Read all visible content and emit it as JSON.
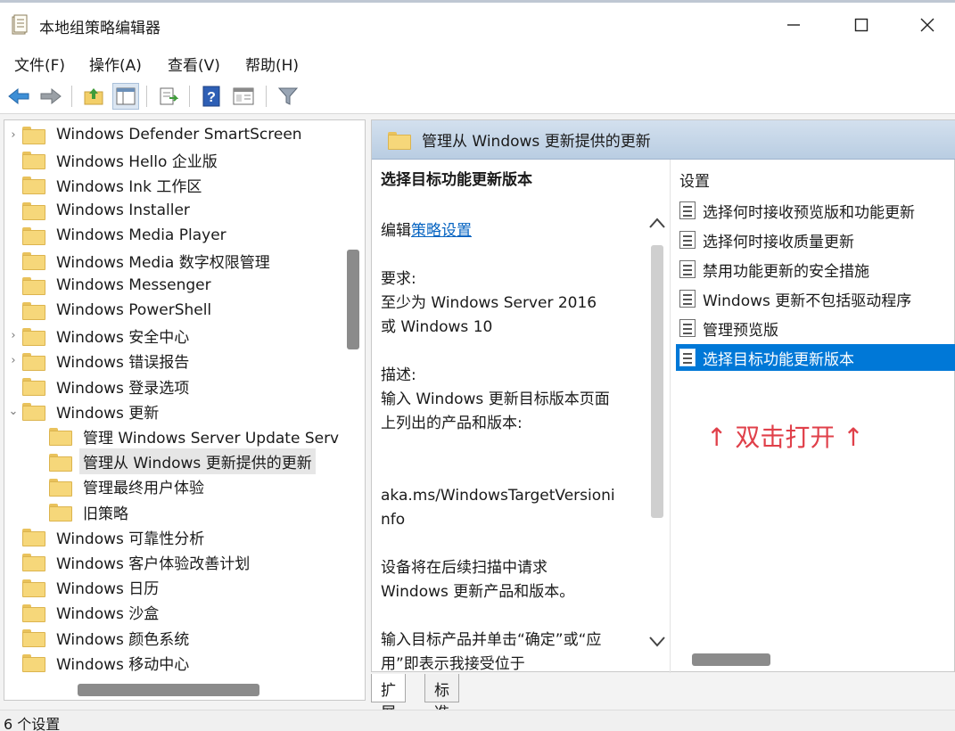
{
  "window": {
    "title": "本地组策略编辑器",
    "minimize_glyph": "—",
    "maximize_glyph": "☐",
    "close_glyph": "✕"
  },
  "menu": {
    "items": [
      {
        "label": "文件(F)"
      },
      {
        "label": "操作(A)"
      },
      {
        "label": "查看(V)"
      },
      {
        "label": "帮助(H)"
      }
    ]
  },
  "toolbar": {
    "icons": [
      "back-icon",
      "forward-icon",
      "up-folder-icon",
      "show-hide-tree-icon",
      "export-list-icon",
      "help-icon",
      "properties-icon",
      "filter-icon"
    ]
  },
  "tree": {
    "items": [
      {
        "label": "Windows Defender SmartScreen",
        "chevron": "›"
      },
      {
        "label": "Windows Hello 企业版",
        "chevron": ""
      },
      {
        "label": "Windows Ink 工作区",
        "chevron": ""
      },
      {
        "label": "Windows Installer",
        "chevron": ""
      },
      {
        "label": "Windows Media Player",
        "chevron": ""
      },
      {
        "label": "Windows Media 数字权限管理",
        "chevron": ""
      },
      {
        "label": "Windows Messenger",
        "chevron": ""
      },
      {
        "label": "Windows PowerShell",
        "chevron": ""
      },
      {
        "label": "Windows 安全中心",
        "chevron": "›"
      },
      {
        "label": "Windows 错误报告",
        "chevron": "›"
      },
      {
        "label": "Windows 登录选项",
        "chevron": ""
      },
      {
        "label": "Windows 更新",
        "chevron": "⌄"
      },
      {
        "label": "管理 Windows Server Update Serv",
        "chevron": ""
      },
      {
        "label": "管理从 Windows 更新提供的更新",
        "chevron": ""
      },
      {
        "label": "管理最终用户体验",
        "chevron": ""
      },
      {
        "label": "旧策略",
        "chevron": ""
      },
      {
        "label": "Windows 可靠性分析",
        "chevron": ""
      },
      {
        "label": "Windows 客户体验改善计划",
        "chevron": ""
      },
      {
        "label": "Windows 日历",
        "chevron": ""
      },
      {
        "label": "Windows 沙盒",
        "chevron": ""
      },
      {
        "label": "Windows 颜色系统",
        "chevron": ""
      },
      {
        "label": "Windows 移动中心",
        "chevron": ""
      }
    ]
  },
  "right": {
    "header_title": "管理从 Windows 更新提供的更新",
    "description": {
      "title": "选择目标功能更新版本",
      "edit_prefix": "编辑",
      "edit_link": "策略设置",
      "requirement_label": "要求:",
      "requirement_line1": "至少为 Windows Server 2016",
      "requirement_line2": "或 Windows 10",
      "desc_label": "描述:",
      "desc_line1": "输入 Windows 更新目标版本页面",
      "desc_line2": "上列出的产品和版本:",
      "url_line1": "aka.ms/WindowsTargetVersioni",
      "url_line2": "nfo",
      "p2_line1": "设备将在后续扫描中请求",
      "p2_line2": "Windows 更新产品和版本。",
      "p3_line1": "输入目标产品并单击“确定”或“应",
      "p3_line2": "用”即表示我接受位于",
      "scroll_up": "︿",
      "scroll_down": "﹀"
    },
    "settings": {
      "header": "设置",
      "items": [
        {
          "label": "选择何时接收预览版和功能更新"
        },
        {
          "label": "选择何时接收质量更新"
        },
        {
          "label": "禁用功能更新的安全措施"
        },
        {
          "label": "Windows 更新不包括驱动程序"
        },
        {
          "label": "管理预览版"
        },
        {
          "label": "选择目标功能更新版本"
        }
      ],
      "annotation": "↑ 双击打开 ↑"
    }
  },
  "tabs": [
    {
      "label": "扩展"
    },
    {
      "label": "标准"
    }
  ],
  "status": {
    "text": "6 个设置"
  }
}
